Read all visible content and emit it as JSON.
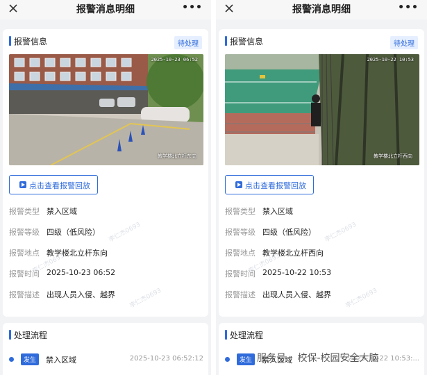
{
  "panels": [
    {
      "nav": {
        "title": "报警消息明细",
        "more": "•••"
      },
      "info": {
        "title": "报警信息",
        "status": "待处理",
        "camera": {
          "timestamp": "2025-10-23 06:52",
          "location_overlay": "教学楼北立杆东向"
        },
        "replay_label": "点击查看报警回放",
        "fields": [
          {
            "label": "报警类型",
            "value": "禁入区域"
          },
          {
            "label": "报警等级",
            "value": "四级（低风险）"
          },
          {
            "label": "报警地点",
            "value": "教学楼北立杆东向"
          },
          {
            "label": "报警时间",
            "value": "2025-10-23 06:52"
          },
          {
            "label": "报警描述",
            "value": "出现人员入侵、越界"
          }
        ]
      },
      "process": {
        "title": "处理流程",
        "steps": [
          {
            "tag": "发生",
            "name": "禁入区域",
            "time": "2025-10-23 06:52:12"
          }
        ]
      },
      "watermark": "李仁杰0693"
    },
    {
      "nav": {
        "title": "报警消息明细",
        "more": "•••"
      },
      "info": {
        "title": "报警信息",
        "status": "待处理",
        "camera": {
          "timestamp": "2025-10-22 10:53",
          "location_overlay": "教学楼北立杆西向"
        },
        "replay_label": "点击查看报警回放",
        "fields": [
          {
            "label": "报警类型",
            "value": "禁入区域"
          },
          {
            "label": "报警等级",
            "value": "四级（低风险）"
          },
          {
            "label": "报警地点",
            "value": "教学楼北立杆西向"
          },
          {
            "label": "报警时间",
            "value": "2025-10-22 10:53"
          },
          {
            "label": "报警描述",
            "value": "出现人员入侵、越界"
          }
        ]
      },
      "process": {
        "title": "处理流程",
        "steps": [
          {
            "tag": "发生",
            "name": "禁入区域",
            "time": "2025-10-22 10:53:..."
          }
        ]
      },
      "watermark": "李仁杰0693"
    }
  ],
  "footer_watermark": {
    "account": "服务号",
    "separator": "·",
    "name": "校保-校园安全大脑"
  },
  "colors": {
    "accent": "#2f6bdb",
    "tag_bg": "#e6efff",
    "label": "#999999"
  }
}
